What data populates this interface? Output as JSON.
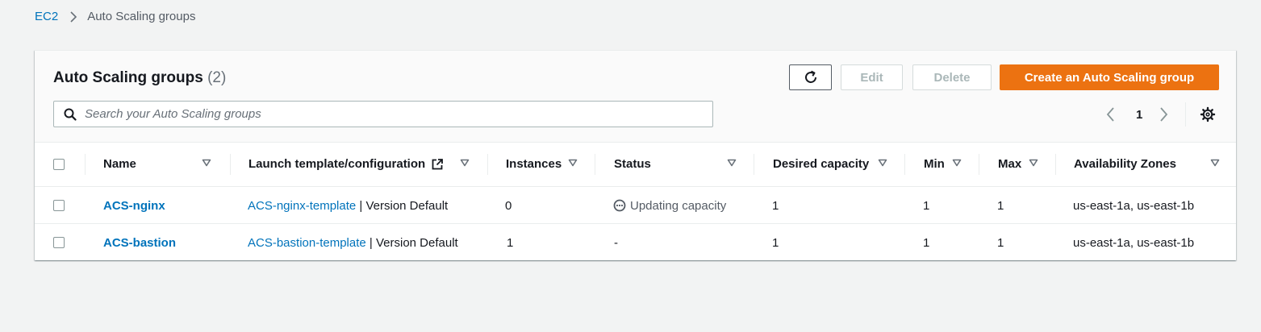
{
  "breadcrumb": {
    "parent": "EC2",
    "current": "Auto Scaling groups"
  },
  "header": {
    "title": "Auto Scaling groups",
    "count": "(2)",
    "buttons": {
      "refresh_icon": "refresh-icon",
      "edit": "Edit",
      "delete": "Delete",
      "create": "Create an Auto Scaling group"
    },
    "search": {
      "placeholder": "Search your Auto Scaling groups",
      "value": ""
    },
    "pagination": {
      "current_page": "1"
    }
  },
  "table": {
    "columns": [
      "Name",
      "Launch template/configuration",
      "Instances",
      "Status",
      "Desired capacity",
      "Min",
      "Max",
      "Availability Zones"
    ],
    "rows": [
      {
        "name": "ACS-nginx",
        "template": "ACS-nginx-template",
        "version": " | Version Default",
        "instances": "0",
        "status": "Updating capacity",
        "status_icon": "ellipsis-circle-icon",
        "desired": "1",
        "min": "1",
        "max": "1",
        "zones": "us-east-1a, us-east-1b"
      },
      {
        "name": "ACS-bastion",
        "template": "ACS-bastion-template",
        "version": " | Version Default",
        "instances": "1",
        "status": "-",
        "desired": "1",
        "min": "1",
        "max": "1",
        "zones": "us-east-1a, us-east-1b"
      }
    ]
  },
  "colors": {
    "primary_button": "#ec7211",
    "link": "#0073bb",
    "background": "#f2f3f3"
  }
}
